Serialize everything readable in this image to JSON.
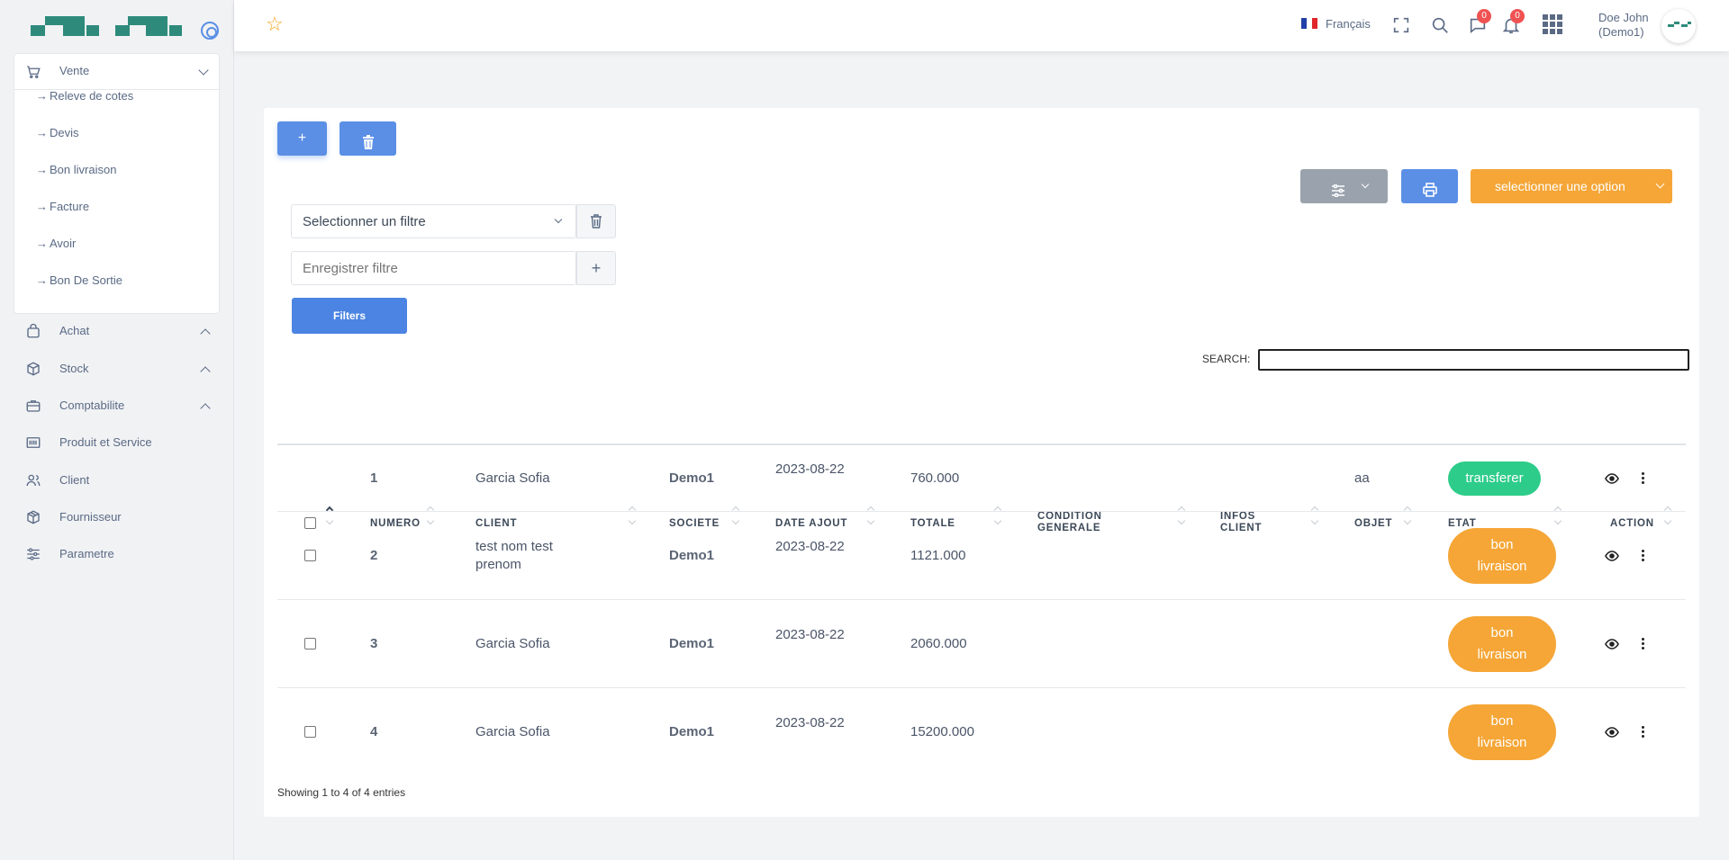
{
  "sidebar": {
    "menus": [
      {
        "label": "Vente",
        "icon": "cart-icon",
        "expanded": true,
        "items": [
          "Releve de cotes",
          "Devis",
          "Bon livraison",
          "Facture",
          "Avoir",
          "Bon De Sortie"
        ]
      },
      {
        "label": "Achat",
        "icon": "bag-icon"
      },
      {
        "label": "Stock",
        "icon": "box-icon"
      },
      {
        "label": "Comptabilite",
        "icon": "briefcase-icon"
      },
      {
        "label": "Produit et Service",
        "icon": "barcode-icon"
      },
      {
        "label": "Client",
        "icon": "users-icon"
      },
      {
        "label": "Fournisseur",
        "icon": "package-icon"
      },
      {
        "label": "Parametre",
        "icon": "sliders-icon"
      }
    ],
    "sub_arrow": "→"
  },
  "topbar": {
    "language": "Français",
    "messages_count": "0",
    "notifications_count": "0",
    "user_name": "Doe John",
    "user_company": "(Demo1)"
  },
  "toolbar": {
    "add_label": "+",
    "option_label": "selectionner une option",
    "filter_select_placeholder": "Selectionner un filtre",
    "filter_save_placeholder": "Enregistrer filtre",
    "filter_add_label": "+",
    "filters_button": "Filters",
    "search_label": "SEARCH:"
  },
  "table": {
    "columns": [
      "NUMERO",
      "CLIENT",
      "SOCIETE",
      "DATE AJOUT",
      "TOTALE",
      "CONDITION GENERALE",
      "INFOS CLIENT",
      "OBJET",
      "ETAT",
      "ACTION"
    ],
    "rows": [
      {
        "numero": "1",
        "client": "Garcia Sofia",
        "societe": "Demo1",
        "date": "2023-08-22",
        "totale": "760.000",
        "condition": "",
        "infos": "",
        "objet": "aa",
        "etat": "transferer",
        "etat_color": "#2ecc8a"
      },
      {
        "numero": "2",
        "client": "test nom test prenom",
        "societe": "Demo1",
        "date": "2023-08-22",
        "totale": "1121.000",
        "condition": "",
        "infos": "",
        "objet": "",
        "etat": "bon livraison",
        "etat_color": "#f5a637"
      },
      {
        "numero": "3",
        "client": "Garcia Sofia",
        "societe": "Demo1",
        "date": "2023-08-22",
        "totale": "2060.000",
        "condition": "",
        "infos": "",
        "objet": "",
        "etat": "bon livraison",
        "etat_color": "#f5a637"
      },
      {
        "numero": "4",
        "client": "Garcia Sofia",
        "societe": "Demo1",
        "date": "2023-08-22",
        "totale": "15200.000",
        "condition": "",
        "infos": "",
        "objet": "",
        "etat": "bon livraison",
        "etat_color": "#f5a637"
      }
    ],
    "footer": "Showing 1 to 4 of 4 entries"
  },
  "colors": {
    "primary": "#5b8fe6",
    "accent_orange": "#f5a637",
    "success": "#2ecc8a",
    "brand": "#2e8b7c"
  }
}
